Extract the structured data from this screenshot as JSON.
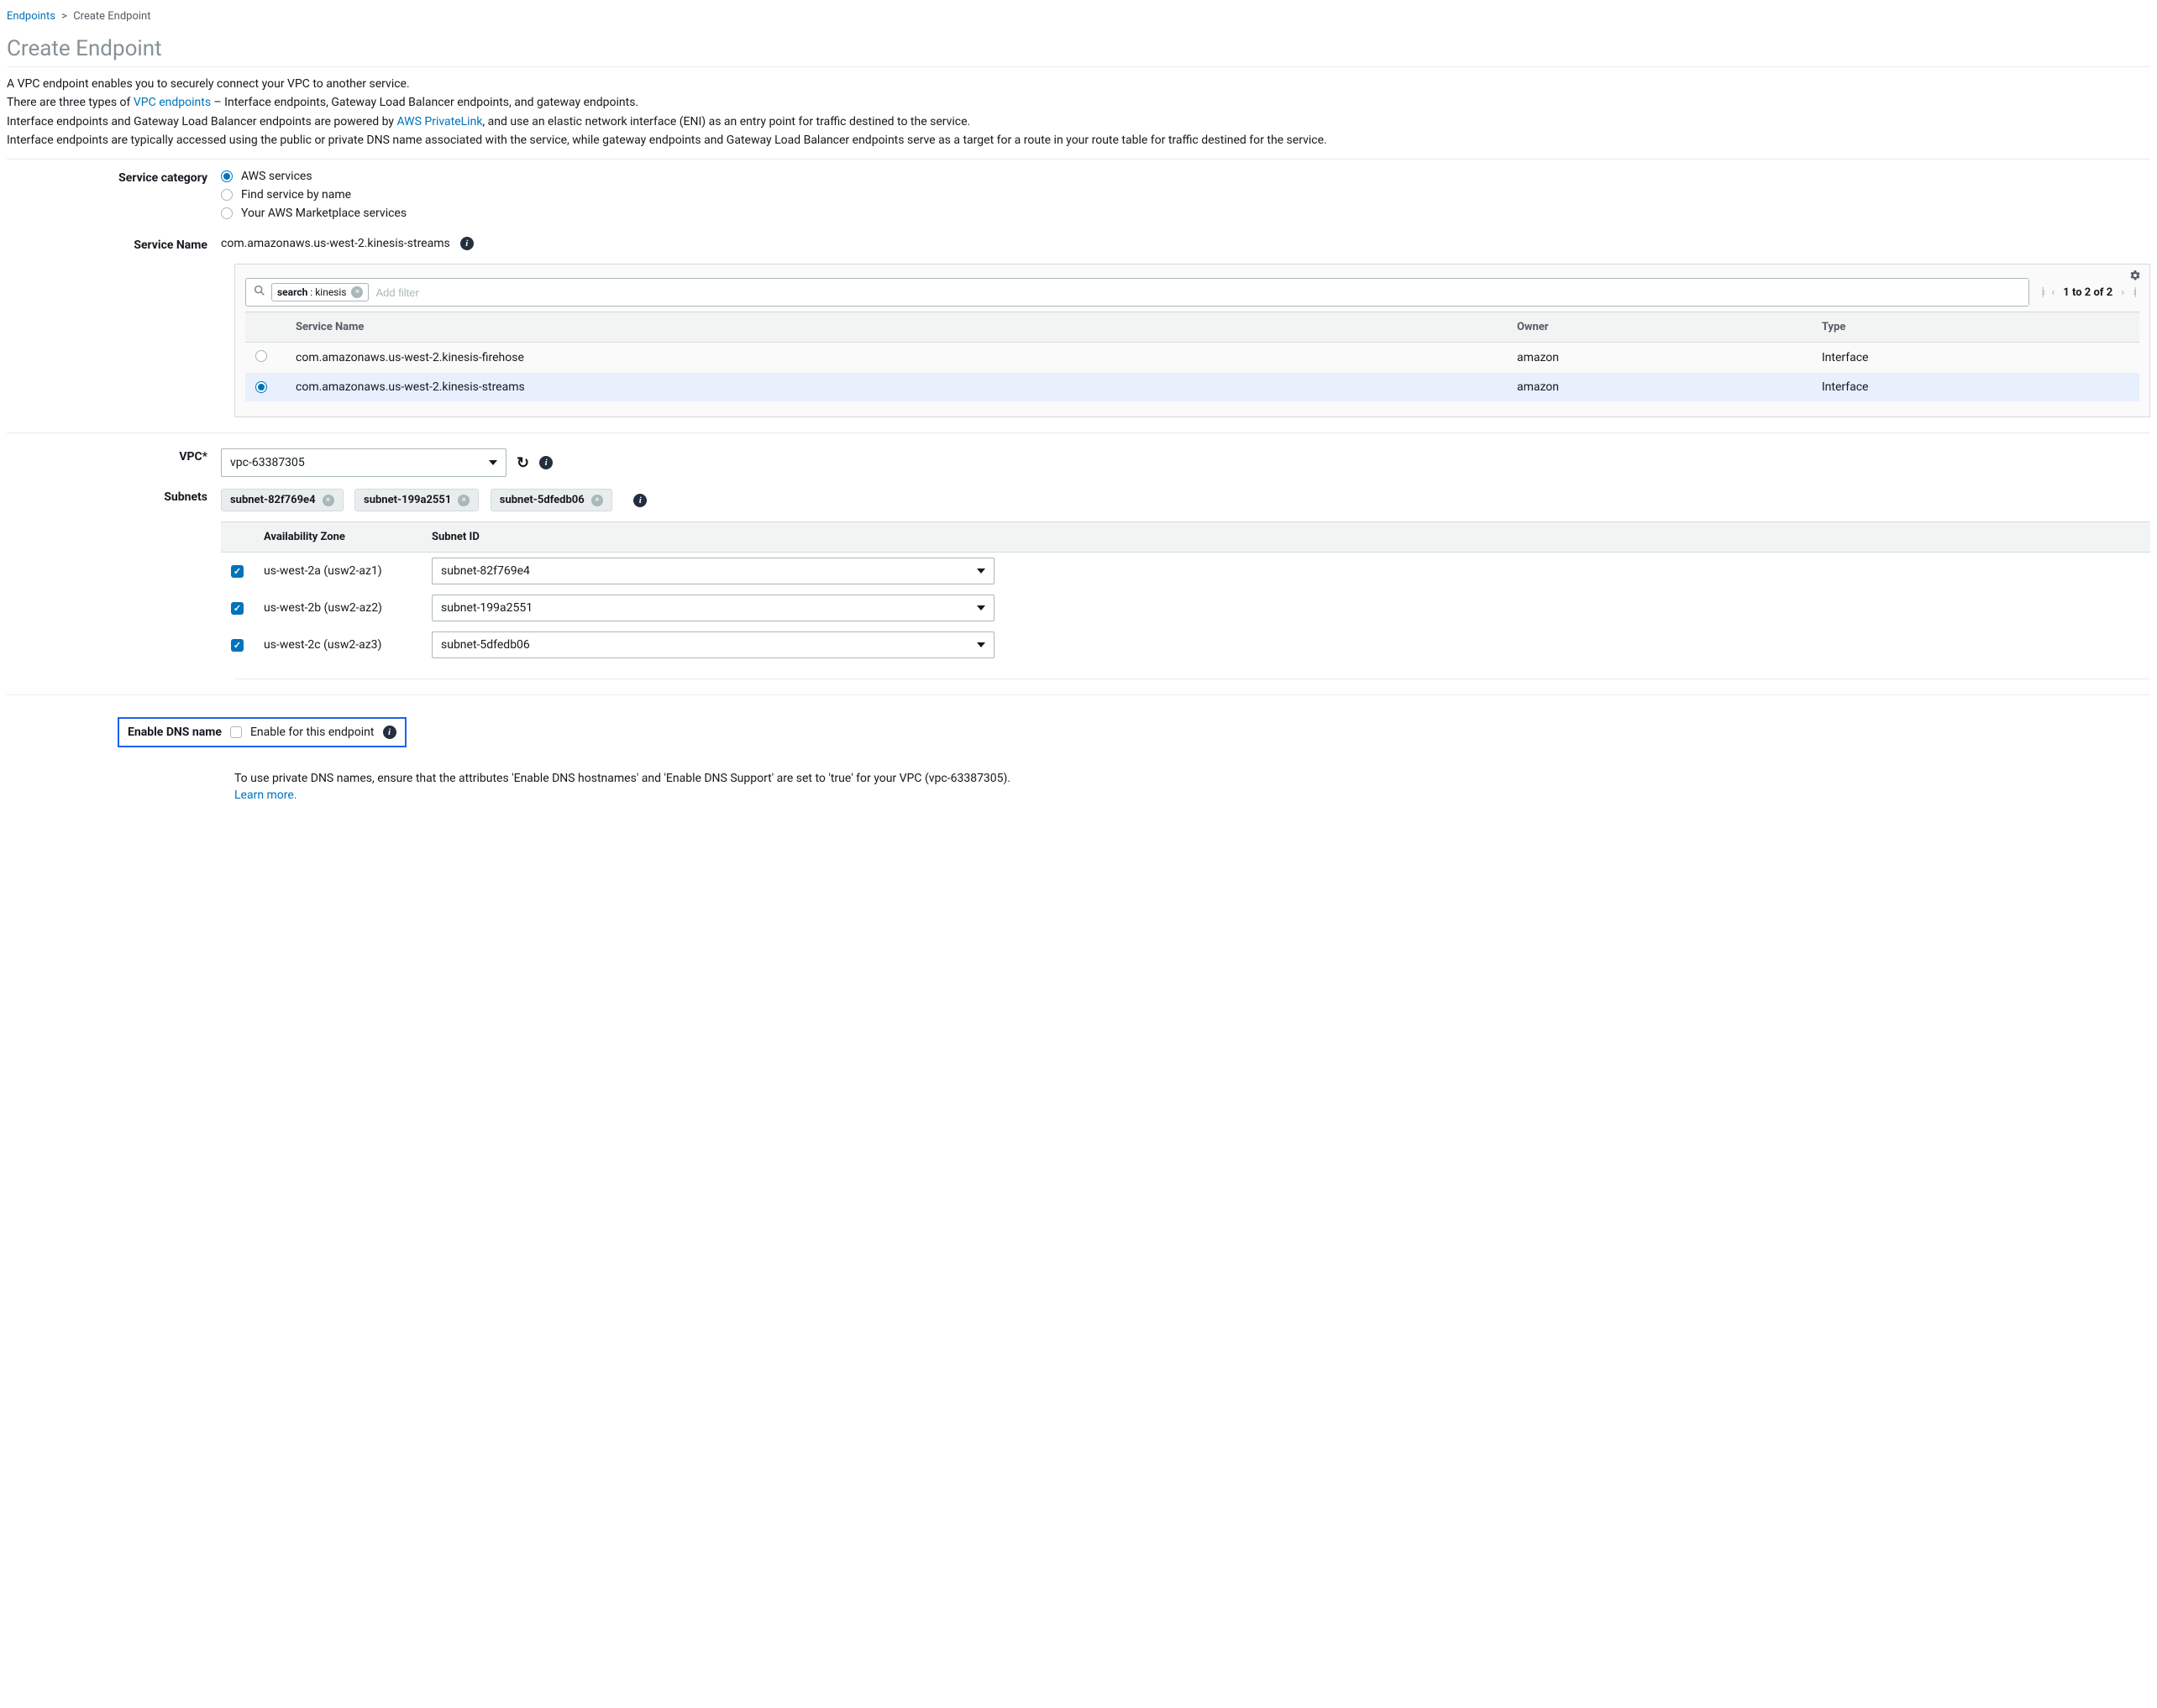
{
  "breadcrumb": {
    "root": "Endpoints",
    "current": "Create Endpoint"
  },
  "title": "Create Endpoint",
  "intro": {
    "l1": "A VPC endpoint enables you to securely connect your VPC to another service.",
    "l2a": "There are three types of ",
    "l2link": "VPC endpoints",
    "l2b": " – Interface endpoints, Gateway Load Balancer endpoints, and gateway endpoints.",
    "l3a": "Interface endpoints and Gateway Load Balancer endpoints are powered by ",
    "l3link": "AWS PrivateLink",
    "l3b": ", and use an elastic network interface (ENI) as an entry point for traffic destined to the service.",
    "l4": "Interface endpoints are typically accessed using the public or private DNS name associated with the service, while gateway endpoints and Gateway Load Balancer endpoints serve as a target for a route in your route table for traffic destined for the service."
  },
  "labels": {
    "service_category": "Service category",
    "service_name": "Service Name",
    "vpc": "VPC*",
    "subnets": "Subnets",
    "enable_dns": "Enable DNS name",
    "enable_for_endpoint": "Enable for this endpoint",
    "learn_more": "Learn more"
  },
  "service_category": {
    "options": [
      {
        "label": "AWS services",
        "selected": true
      },
      {
        "label": "Find service by name",
        "selected": false
      },
      {
        "label": "Your AWS Marketplace services",
        "selected": false
      }
    ]
  },
  "service_name_value": "com.amazonaws.us-west-2.kinesis-streams",
  "search": {
    "chip_key": "search",
    "chip_val": "kinesis",
    "placeholder": "Add filter",
    "page_text": "1 to 2 of 2"
  },
  "svc_headers": {
    "name": "Service Name",
    "owner": "Owner",
    "type": "Type"
  },
  "svc_rows": [
    {
      "name": "com.amazonaws.us-west-2.kinesis-firehose",
      "owner": "amazon",
      "type": "Interface",
      "selected": false
    },
    {
      "name": "com.amazonaws.us-west-2.kinesis-streams",
      "owner": "amazon",
      "type": "Interface",
      "selected": true
    }
  ],
  "vpc_value": "vpc-63387305",
  "subnet_tags": [
    "subnet-82f769e4",
    "subnet-199a2551",
    "subnet-5dfedb06"
  ],
  "subnet_headers": {
    "az": "Availability Zone",
    "id": "Subnet ID"
  },
  "subnet_rows": [
    {
      "az": "us-west-2a (usw2-az1)",
      "id": "subnet-82f769e4"
    },
    {
      "az": "us-west-2b (usw2-az2)",
      "id": "subnet-199a2551"
    },
    {
      "az": "us-west-2c (usw2-az3)",
      "id": "subnet-5dfedb06"
    }
  ],
  "dns_note": "To use private DNS names, ensure that the attributes 'Enable DNS hostnames' and 'Enable DNS Support' are set to 'true' for your VPC (vpc-63387305)."
}
